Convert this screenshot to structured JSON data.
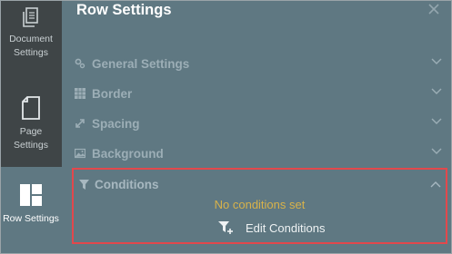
{
  "sidebar": {
    "items": [
      {
        "label_line1": "Document",
        "label_line2": "Settings",
        "icon": "document-icon",
        "active": false
      },
      {
        "label_line1": "Page",
        "label_line2": "Settings",
        "icon": "page-icon",
        "active": false
      },
      {
        "label_line1": "Row Settings",
        "icon": "row-layout-icon",
        "active": true
      }
    ]
  },
  "panel": {
    "title": "Row Settings",
    "sections": [
      {
        "label": "General Settings",
        "icon": "gears-icon"
      },
      {
        "label": "Border",
        "icon": "border-icon"
      },
      {
        "label": "Spacing",
        "icon": "spacing-arrows-icon"
      },
      {
        "label": "Background",
        "icon": "image-icon"
      }
    ],
    "conditions": {
      "label": "Conditions",
      "icon": "filter-icon",
      "empty_text": "No conditions set",
      "edit_label": "Edit Conditions",
      "edit_icon": "filter-plus-icon"
    }
  },
  "colors": {
    "panel_bg": "#5f7882",
    "sidebar_bg": "#3f4547",
    "highlight_border": "#e2484c",
    "empty_text": "#d8b24a"
  }
}
